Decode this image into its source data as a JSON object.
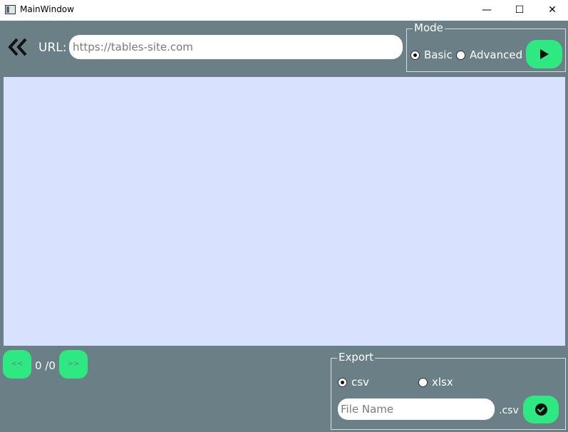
{
  "window": {
    "title": "MainWindow",
    "minimize_glyph": "—",
    "maximize_glyph": "☐",
    "close_glyph": "✕"
  },
  "toolbar": {
    "back_icon": "double-chevron-left-icon",
    "url_label": "URL:",
    "url_placeholder": "https://tables-site.com",
    "url_value": ""
  },
  "mode": {
    "legend": "Mode",
    "options": [
      {
        "label": "Basic",
        "checked": true
      },
      {
        "label": "Advanced",
        "checked": false
      }
    ],
    "run_icon": "play-icon"
  },
  "pager": {
    "prev_label": "<<",
    "next_label": ">>",
    "count_text": "0 /0"
  },
  "export": {
    "legend": "Export",
    "options": [
      {
        "label": "csv",
        "checked": true
      },
      {
        "label": "xlsx",
        "checked": false
      }
    ],
    "file_placeholder": "File Name",
    "extension": ".csv",
    "confirm_icon": "check-circle-icon"
  },
  "colors": {
    "background": "#6b7f87",
    "accent": "#2ee882",
    "table_background": "#d8e2fe"
  }
}
